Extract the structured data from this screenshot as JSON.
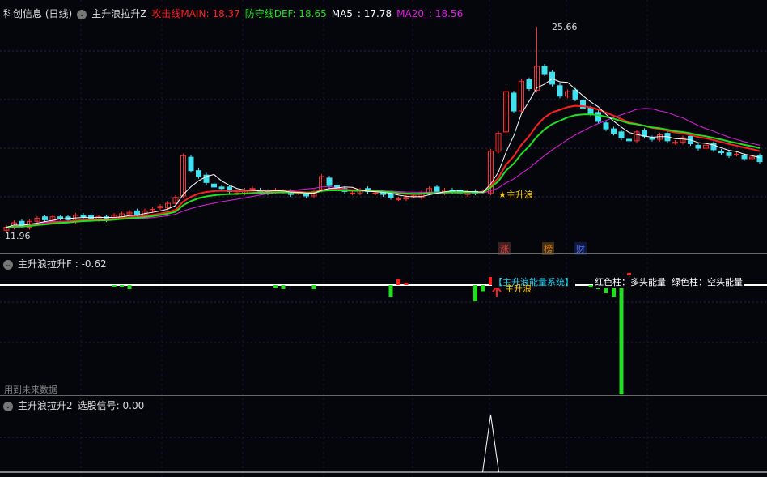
{
  "main": {
    "stock": "科创信息 (日线)",
    "indicator": "主升浪拉升Z",
    "main_line": "攻击线MAIN: 18.37",
    "def_line": "防守线DEF: 18.65",
    "ma5": "MA5_: 17.78",
    "ma20": "MA20_: 18.56",
    "high_label": "25.66",
    "low_label": "11.96",
    "signal_label": "★主升浪",
    "colors": {
      "main": "#ff2020",
      "def": "#20e020",
      "ma5": "#ffffff",
      "ma20": "#e020e0",
      "up": "#ff3030",
      "down": "#40e0f0"
    },
    "closes": [
      12.2,
      12.5,
      12.3,
      12.6,
      12.8,
      12.7,
      12.9,
      12.8,
      12.7,
      13.0,
      12.9,
      12.8,
      12.9,
      12.7,
      13.0,
      13.1,
      13.2,
      13.0,
      13.3,
      13.4,
      13.6,
      13.8,
      14.2,
      17.0,
      16.0,
      15.6,
      15.2,
      14.9,
      14.8,
      14.6,
      14.5,
      14.7,
      14.8,
      14.6,
      14.5,
      14.7,
      14.6,
      14.4,
      14.5,
      14.3,
      14.6,
      15.6,
      15.0,
      14.7,
      14.6,
      14.5,
      14.7,
      14.6,
      14.5,
      14.4,
      14.2,
      14.1,
      14.2,
      14.3,
      14.5,
      14.8,
      14.6,
      14.7,
      14.6,
      14.5,
      14.6,
      14.5,
      14.6,
      17.3,
      18.5,
      21.3,
      20.0,
      22.0,
      21.5,
      23.0,
      22.5,
      21.8,
      21.0,
      21.3,
      20.8,
      20.2,
      19.8,
      19.3,
      18.8,
      18.5,
      18.2,
      18.0,
      18.6,
      18.3,
      18.1,
      18.4,
      18.0,
      17.9,
      18.2,
      17.8,
      17.5,
      17.7,
      17.4,
      17.2,
      17.0,
      17.1,
      16.8,
      16.9,
      16.6
    ],
    "tags": [
      {
        "text": "涨",
        "color": "#e04040"
      },
      {
        "text": "榜",
        "color": "#e08020"
      },
      {
        "text": "财",
        "color": "#4060ff"
      }
    ]
  },
  "energy": {
    "indicator": "主升浪拉升F : -0.62",
    "system_label": "【主升浪能量系统】",
    "legend": "红色柱：多头能量  绿色柱：空头能量",
    "signal_label": "主升浪",
    "future_note": "用到未来数据",
    "bars": {
      "14": -0.05,
      "15": -0.05,
      "16": -0.1,
      "35": -0.08,
      "36": -0.1,
      "40": -0.1,
      "50": -0.3,
      "51": 0.15,
      "52": 0.06,
      "61": -0.4,
      "62": -0.15,
      "63": 0.2,
      "76": -0.06,
      "77": -0.1,
      "78": -0.2,
      "79": -0.3,
      "80": -2.7,
      "81": 0.3,
      "82": 0.1
    }
  },
  "select": {
    "indicator": "主升浪拉升2",
    "signal": "选股信号: 0.00",
    "spike_index": 63
  }
}
